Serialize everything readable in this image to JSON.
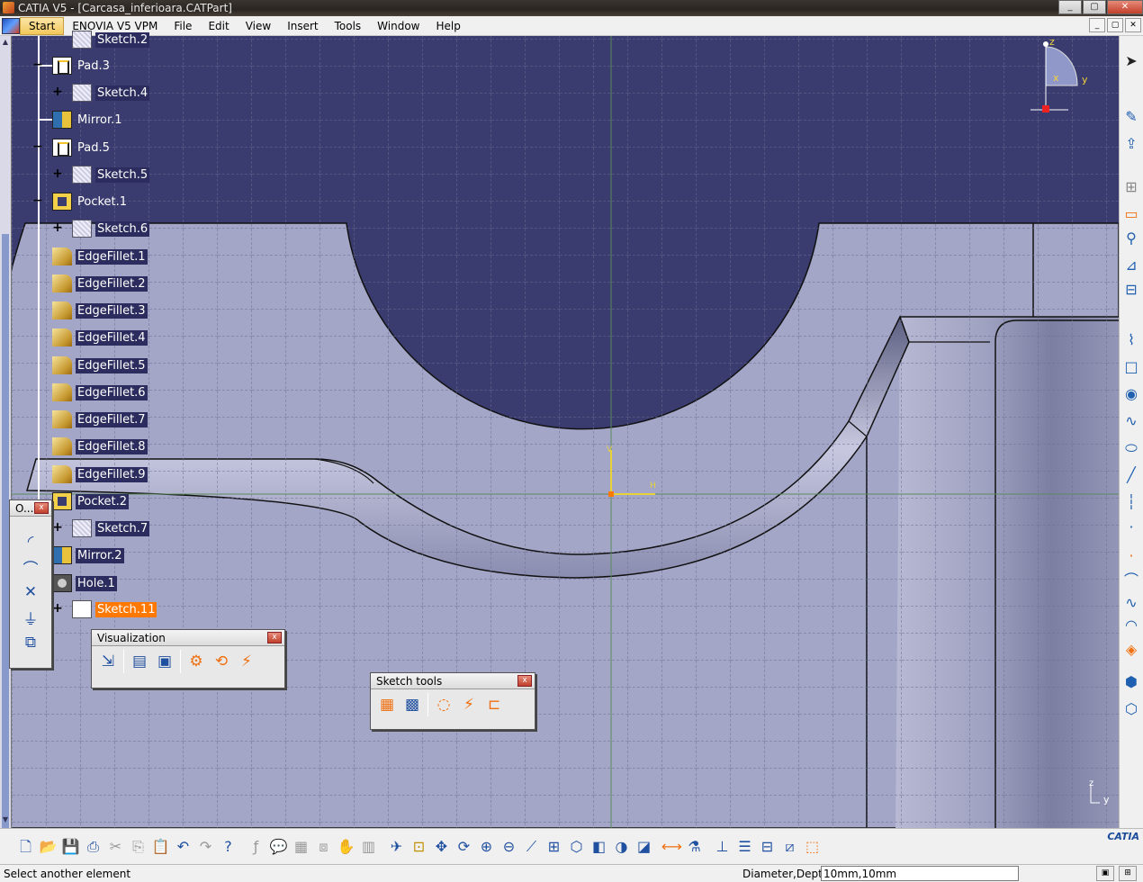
{
  "window": {
    "title": "CATIA V5 - [Carcasa_inferioara.CATPart]",
    "buttons": [
      "_",
      "▢",
      "✕"
    ]
  },
  "menu": {
    "items": [
      "Start",
      "ENOVIA V5 VPM",
      "File",
      "Edit",
      "View",
      "Insert",
      "Tools",
      "Window",
      "Help"
    ]
  },
  "tree": {
    "nodes": [
      {
        "label": "Sketch.2",
        "type": "sketch"
      },
      {
        "label": "Pad.3",
        "type": "pad"
      },
      {
        "label": "Sketch.4",
        "type": "sketch"
      },
      {
        "label": "Mirror.1",
        "type": "mirror"
      },
      {
        "label": "Pad.5",
        "type": "pad"
      },
      {
        "label": "Sketch.5",
        "type": "sketch"
      },
      {
        "label": "Pocket.1",
        "type": "pocket"
      },
      {
        "label": "Sketch.6",
        "type": "sketch"
      },
      {
        "label": "EdgeFillet.1",
        "type": "fillet"
      },
      {
        "label": "EdgeFillet.2",
        "type": "fillet"
      },
      {
        "label": "EdgeFillet.3",
        "type": "fillet"
      },
      {
        "label": "EdgeFillet.4",
        "type": "fillet"
      },
      {
        "label": "EdgeFillet.5",
        "type": "fillet"
      },
      {
        "label": "EdgeFillet.6",
        "type": "fillet"
      },
      {
        "label": "EdgeFillet.7",
        "type": "fillet"
      },
      {
        "label": "EdgeFillet.8",
        "type": "fillet"
      },
      {
        "label": "EdgeFillet.9",
        "type": "fillet"
      },
      {
        "label": "Pocket.2",
        "type": "pocket"
      },
      {
        "label": "Sketch.7",
        "type": "sketch"
      },
      {
        "label": "Mirror.2",
        "type": "mirror"
      },
      {
        "label": "Hole.1",
        "type": "hole"
      },
      {
        "label": "Sketch.11",
        "type": "sketch11"
      }
    ]
  },
  "toolbars": {
    "operation": {
      "title": "O...",
      "close": "x"
    },
    "visualization": {
      "title": "Visualization",
      "close": "x"
    },
    "sketch_tools": {
      "title": "Sketch tools",
      "close": "x"
    }
  },
  "compass": {
    "z": "z",
    "x": "x",
    "y": "y"
  },
  "axis": {
    "v": "V",
    "h": "H"
  },
  "corner_axis": {
    "y": "y",
    "z": "z"
  },
  "status": {
    "message": "Select another element",
    "param_label": "Diameter,Depth",
    "param_value": "10mm,10mm"
  },
  "brand": {
    "logo": "CATIA"
  },
  "colors": {
    "viewport": "#3a3b6e",
    "part_face": "#a4a6c8",
    "selection": "#ff7800",
    "sketch_axis": "#e8d23a"
  }
}
